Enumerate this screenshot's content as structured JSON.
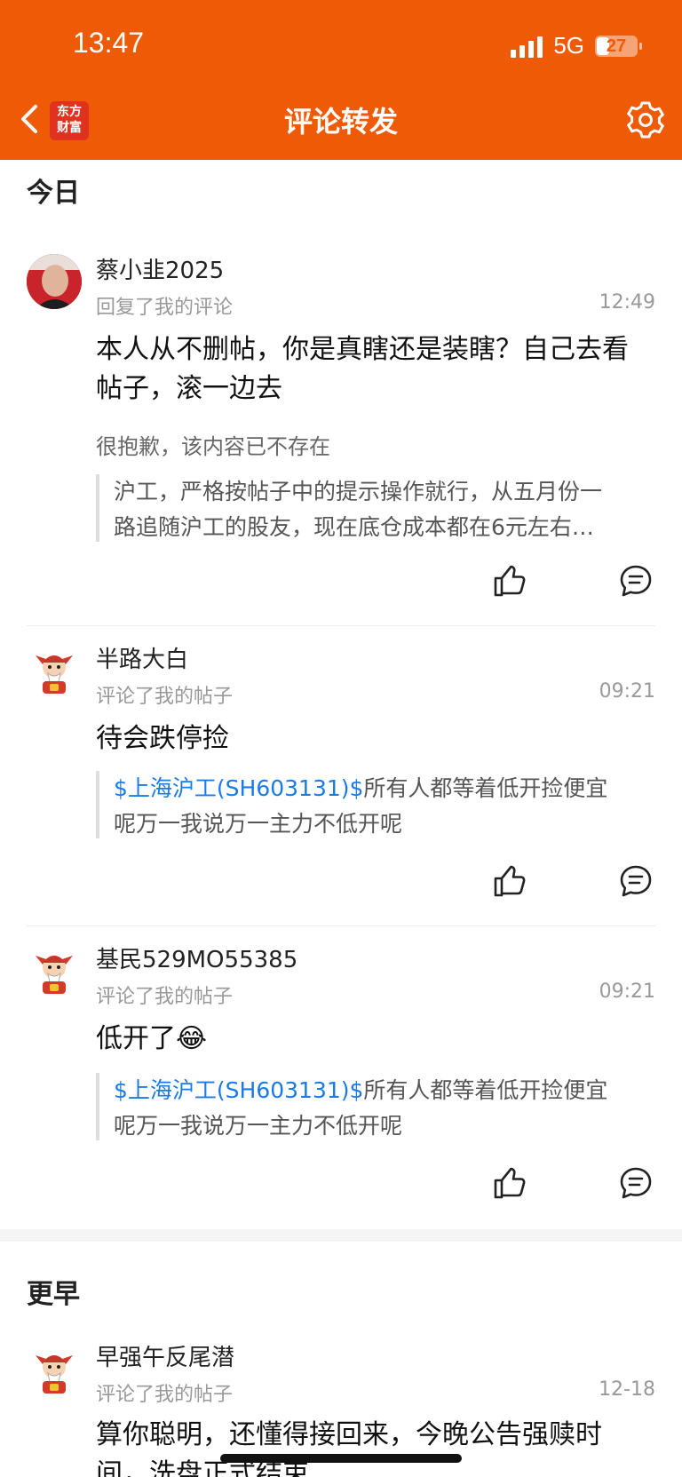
{
  "status_bar": {
    "time": "13:47",
    "network": "5G",
    "battery": "27"
  },
  "header": {
    "title": "评论转发",
    "logo_text_line1": "东方",
    "logo_text_line2": "财富"
  },
  "sections": [
    {
      "title": "今日"
    },
    {
      "title": "更早"
    }
  ],
  "items": [
    {
      "name": "蔡小韭2025",
      "subtype": "回复了我的评论",
      "time": "12:49",
      "content": "本人从不删帖，你是真瞎还是装瞎？自己去看帖子，滚一边去",
      "deleted_note": "很抱歉，该内容已不存在",
      "quote_line1": "沪工，严格按帖子中的提示操作就行，从五月份一",
      "quote_line2": "路追随沪工的股友，现在底仓成本都在6元左右…"
    },
    {
      "name": "半路大白",
      "subtype": "评论了我的帖子",
      "time": "09:21",
      "content": "待会跌停捡",
      "quote_stock": "$上海沪工(SH603131)$",
      "quote_line1": "所有人都等着低开捡便宜",
      "quote_line2": "呢万一我说万一主力不低开呢"
    },
    {
      "name": "基民529MO55385",
      "subtype": "评论了我的帖子",
      "time": "09:21",
      "content": "低开了😂",
      "quote_stock": "$上海沪工(SH603131)$",
      "quote_line1": "所有人都等着低开捡便宜",
      "quote_line2": "呢万一我说万一主力不低开呢"
    },
    {
      "name": "早强午反尾潜",
      "subtype": "评论了我的帖子",
      "time": "12-18",
      "content": "算你聪明，还懂得接回来，今晚公告强赎时间，洗盘正式结束"
    }
  ],
  "colors": {
    "brand": "#ef5a06",
    "link": "#1a7be8"
  },
  "icons": [
    "back-arrow-icon",
    "app-logo",
    "settings-gear-icon",
    "thumbs-up-icon",
    "comment-bubble-icon"
  ]
}
